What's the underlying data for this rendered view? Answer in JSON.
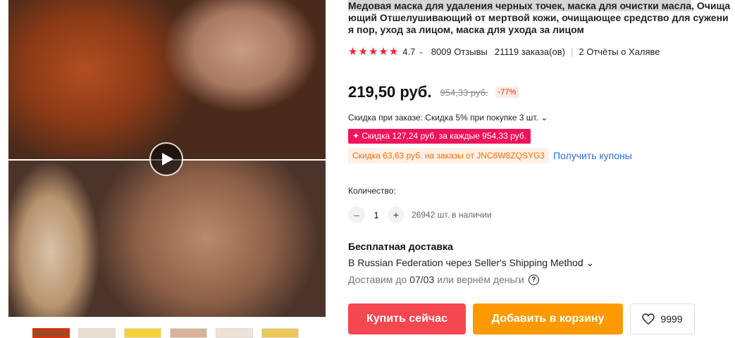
{
  "product": {
    "title_highlight": "Медовая маска для удаления черных точек, маска для очистки масла",
    "title_rest": ", Очищающий Отшелушивающий от мертвой кожи, очищающее средство для сужения пор, уход за лицом, маска для ухода за лицом",
    "rating": "4.7",
    "rating_chevron": "⌄",
    "reviews": "8009 Отзывы",
    "orders": "21119 заказа(ов)",
    "separator": "|",
    "free_reports": "2 Отчёты о Халяве",
    "stars_icon": "star-icon",
    "star_color": "#f5222d"
  },
  "price": {
    "current": "219,50 руб.",
    "old": "954,33 руб.",
    "discount": "-77%"
  },
  "promotions": {
    "store_discount": "Скидка при заказе: Скидка 5% при покупке 3 шт. ⌄",
    "promo_red": "✦ Скидка 127,24 руб. за каждые 954,33 руб.",
    "promo_red_color": "#f0145a",
    "coupon_tag": "Скидка 63,63 руб. на заказы от JNC6W8ZQSYG3",
    "coupon_link": "Получить купоны"
  },
  "quantity": {
    "label": "Количество:",
    "minus": "–",
    "value": "1",
    "plus": "+",
    "stock": "26942 шт. в наличии"
  },
  "shipping": {
    "title": "Бесплатная доставка",
    "route": "В Russian Federation через Seller's Shipping Method ⌄",
    "date_prefix": "Доставим до",
    "date": "07/03",
    "date_suffix": "или вернём деньги",
    "help_icon": "?"
  },
  "actions": {
    "buy_now": "Купить сейчас",
    "add_to_cart": "Добавить в корзину",
    "wishlist_count": "9999",
    "buy_color": "#f5474f",
    "cart_color": "#ff9900"
  },
  "gallery": {
    "play_icon": "play-icon",
    "thumbnail_count": 6
  }
}
